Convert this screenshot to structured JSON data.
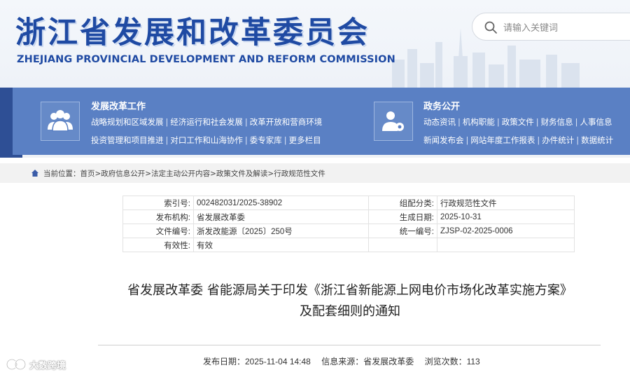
{
  "header": {
    "title_cn": "浙江省发展和改革委员会",
    "title_en": "ZHEJIANG PROVINCIAL DEVELOPMENT AND REFORM COMMISSION",
    "search_placeholder": "请输入关键词"
  },
  "nav": {
    "left": {
      "title": "发展改革工作",
      "row1": [
        "战略规划和区域发展",
        "经济运行和社会发展",
        "改革开放和营商环境"
      ],
      "row2": [
        "投资管理和项目推进",
        "对口工作和山海协作",
        "委专家库",
        "更多栏目"
      ]
    },
    "right": {
      "title": "政务公开",
      "row1": [
        "动态资讯",
        "机构职能",
        "政策文件",
        "财务信息",
        "人事信息"
      ],
      "row2": [
        "新闻发布会",
        "网站年度工作报表",
        "办件统计",
        "数据统计"
      ]
    }
  },
  "breadcrumb": {
    "text": "当前位置：首页>政府信息公开>法定主动公开内容>政策文件及解读>行政规范性文件"
  },
  "meta": {
    "r1": {
      "k1": "索引号:",
      "v1": "002482031/2025-38902",
      "k2": "组配分类:",
      "v2": "行政规范性文件"
    },
    "r2": {
      "k1": "发布机构:",
      "v1": "省发展改革委",
      "k2": "生成日期:",
      "v2": "2025-10-31"
    },
    "r3": {
      "k1": "文件编号:",
      "v1": "浙发改能源〔2025〕250号",
      "k2": "统一编号:",
      "v2": "ZJSP-02-2025-0006"
    },
    "r4": {
      "k1": "有效性:",
      "v1": "有效",
      "k2": "",
      "v2": ""
    }
  },
  "article": {
    "title_line1": "省发展改革委 省能源局关于印发《浙江省新能源上网电价市场化改革实施方案》",
    "title_line2": "及配套细则的通知"
  },
  "pub": {
    "date": "发布日期：2025-11-04 14:48",
    "source": "信息来源：省发展改革委",
    "views": "浏览次数：113"
  },
  "watermark": {
    "text": "大数跨境"
  },
  "colors": {
    "brand_blue": "#1f4aa3",
    "nav_blue": "#5a80c4",
    "nav_dark": "#2e4f95"
  }
}
